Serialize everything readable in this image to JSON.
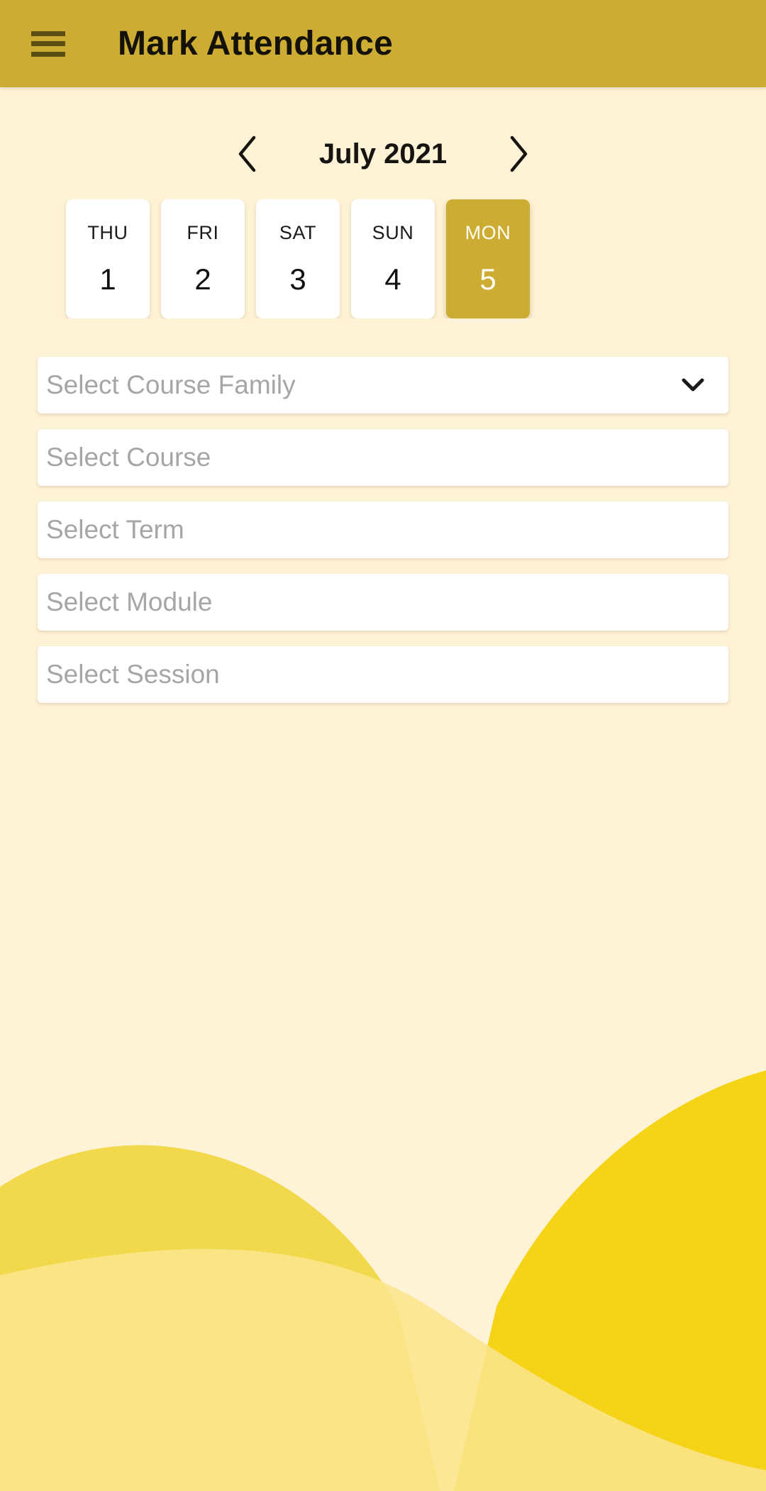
{
  "appbar": {
    "menu_icon": "hamburger-menu-icon",
    "title": "Mark Attendance"
  },
  "calendar": {
    "prev_icon": "chevron-left-icon",
    "next_icon": "chevron-right-icon",
    "month_label": "July 2021",
    "days": [
      {
        "dow": "THU",
        "dom": "1",
        "selected": false
      },
      {
        "dow": "FRI",
        "dom": "2",
        "selected": false
      },
      {
        "dow": "SAT",
        "dom": "3",
        "selected": false
      },
      {
        "dow": "SUN",
        "dom": "4",
        "selected": false
      },
      {
        "dow": "MON",
        "dom": "5",
        "selected": true
      }
    ]
  },
  "fields": [
    {
      "name": "course-family",
      "placeholder": "Select Course Family",
      "value": "",
      "chevron": true
    },
    {
      "name": "course",
      "placeholder": "Select Course",
      "value": "",
      "chevron": false
    },
    {
      "name": "term",
      "placeholder": "Select Term",
      "value": "",
      "chevron": false
    },
    {
      "name": "module",
      "placeholder": "Select Module",
      "value": "",
      "chevron": false
    },
    {
      "name": "session",
      "placeholder": "Select Session",
      "value": "",
      "chevron": false
    }
  ],
  "colors": {
    "appbar": "#CDAC33",
    "background": "#FEF3D6",
    "selected_day": "#CDAC33",
    "menu_icon": "#5C4D12",
    "placeholder_text": "#A6A6A6",
    "hill_left": "#F2D94C",
    "hill_right": "#F5D316",
    "hill_front": "#FAE58C"
  }
}
